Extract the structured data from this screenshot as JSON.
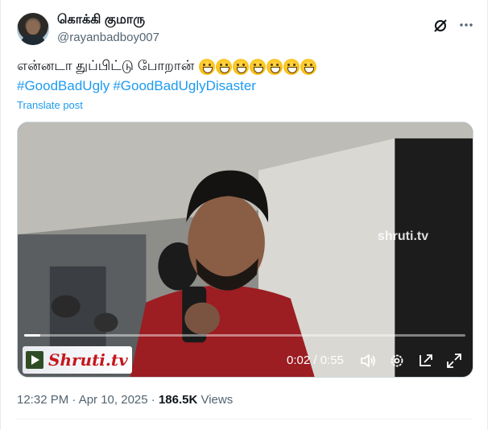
{
  "author": {
    "name": "கொக்கி குமாரு",
    "handle": "@rayanbadboy007"
  },
  "tweet": {
    "text": "என்னடா துப்பிட்டு போறான்",
    "emoji_count": 7,
    "hashtags": [
      "#GoodBadUgly",
      "#GoodBadUglyDisaster"
    ],
    "translate_label": "Translate post"
  },
  "video": {
    "watermark": "shruti.tv",
    "logo_text": "Shruti.tv",
    "time_label": "0:02 / 0:55",
    "progress": 0.036
  },
  "meta": {
    "timestamp": "12:32 PM · Apr 10, 2025 · ",
    "views_count": "186.5K",
    "views_label": " Views"
  },
  "colors": {
    "link": "#1d9bf0",
    "secondary_text": "#536471",
    "logo_red": "#c4161c"
  },
  "icons": [
    "grok-icon",
    "more-icon",
    "volume-icon",
    "settings-icon",
    "pip-icon",
    "fullscreen-icon",
    "play-icon"
  ]
}
